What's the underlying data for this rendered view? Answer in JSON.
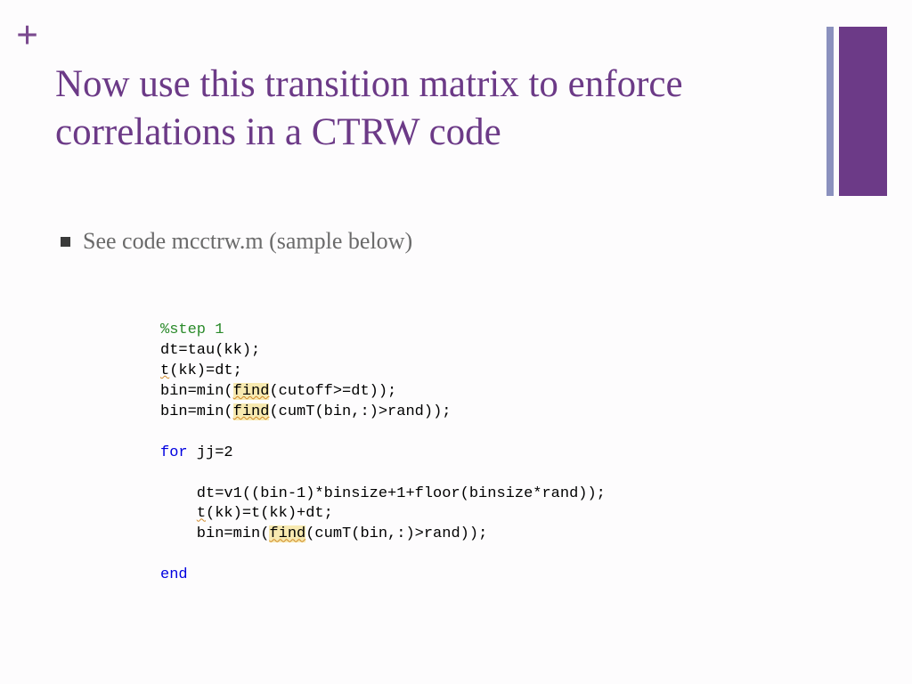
{
  "plus_symbol": "+",
  "title": "Now use this transition matrix to enforce correlations in a CTRW code",
  "bullet": "See code mcctrw.m  (sample below)",
  "code": {
    "l1": "%step 1",
    "l2": "dt=tau(kk);",
    "l3a": "t",
    "l3b": "(kk)=dt;",
    "l4a": "bin=min(",
    "l4b": "find",
    "l4c": "(cutoff>=dt));",
    "l5a": "bin=min(",
    "l5b": "find",
    "l5c": "(cumT(bin,:)>rand));",
    "l7a": "for",
    "l7b": " jj=2",
    "l9": "    dt=v1((bin-1)*binsize+1+floor(binsize*rand));",
    "l10a": "    ",
    "l10b": "t",
    "l10c": "(kk)=t(kk)+dt;",
    "l11a": "    bin=min(",
    "l11b": "find",
    "l11c": "(cumT(bin,:)>rand));",
    "l13": "end"
  }
}
